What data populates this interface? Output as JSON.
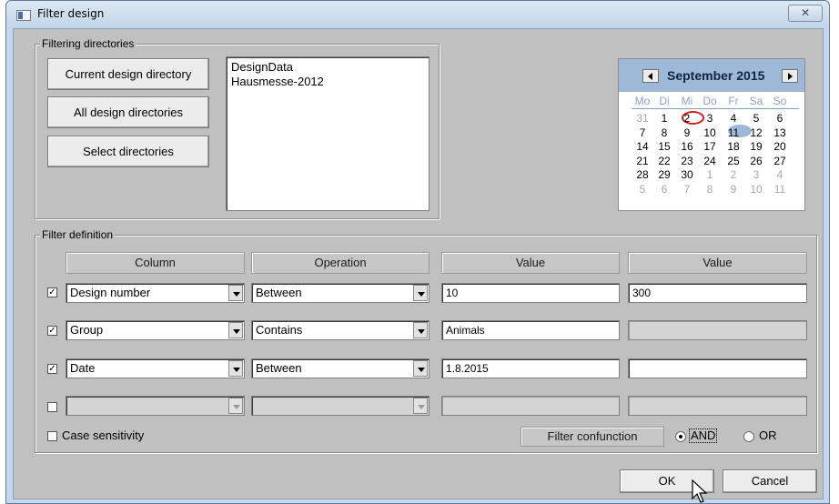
{
  "window": {
    "title": "Filter design",
    "close_glyph": "✕"
  },
  "filtering": {
    "group_label": "Filtering directories",
    "buttons": {
      "current": "Current design directory",
      "all": "All design directories",
      "select": "Select directories"
    },
    "directories": [
      "DesignData",
      "Hausmesse-2012"
    ]
  },
  "calendar": {
    "month_label": "September 2015",
    "weekdays": [
      "Mo",
      "Di",
      "Mi",
      "Do",
      "Fr",
      "Sa",
      "So"
    ],
    "weeks": [
      [
        "31",
        "1",
        "2",
        "3",
        "4",
        "5",
        "6"
      ],
      [
        "7",
        "8",
        "9",
        "10",
        "11",
        "12",
        "13"
      ],
      [
        "14",
        "15",
        "16",
        "17",
        "18",
        "19",
        "20"
      ],
      [
        "21",
        "22",
        "23",
        "24",
        "25",
        "26",
        "27"
      ],
      [
        "28",
        "29",
        "30",
        "1",
        "2",
        "3",
        "4"
      ],
      [
        "5",
        "6",
        "7",
        "8",
        "9",
        "10",
        "11"
      ]
    ],
    "today": "2",
    "selected": "10"
  },
  "filter": {
    "group_label": "Filter definition",
    "headers": [
      "Column",
      "Operation",
      "Value",
      "Value"
    ],
    "rows": [
      {
        "checked": true,
        "column": "Design number",
        "operation": "Between",
        "value1": "10",
        "value2": "300",
        "value2_enabled": true,
        "enabled": true
      },
      {
        "checked": true,
        "column": "Group",
        "operation": "Contains",
        "value1": "Animals",
        "value2": "",
        "value2_enabled": false,
        "enabled": true
      },
      {
        "checked": true,
        "column": "Date",
        "operation": "Between",
        "value1": "1.8.2015",
        "value2": "",
        "value2_enabled": true,
        "enabled": true
      },
      {
        "checked": false,
        "column": "",
        "operation": "",
        "value1": "",
        "value2": "",
        "value2_enabled": false,
        "enabled": false
      }
    ],
    "case_sensitivity_label": "Case sensitivity",
    "conjunction_button": "Filter confunction",
    "and_label": "AND",
    "or_label": "OR",
    "selected_conjunction": "AND"
  },
  "footer": {
    "ok": "OK",
    "cancel": "Cancel"
  },
  "colors": {
    "calendar_header": "#9db9d7",
    "today_ring": "#d81a1a",
    "dialog_bg": "#c0c0c0"
  }
}
